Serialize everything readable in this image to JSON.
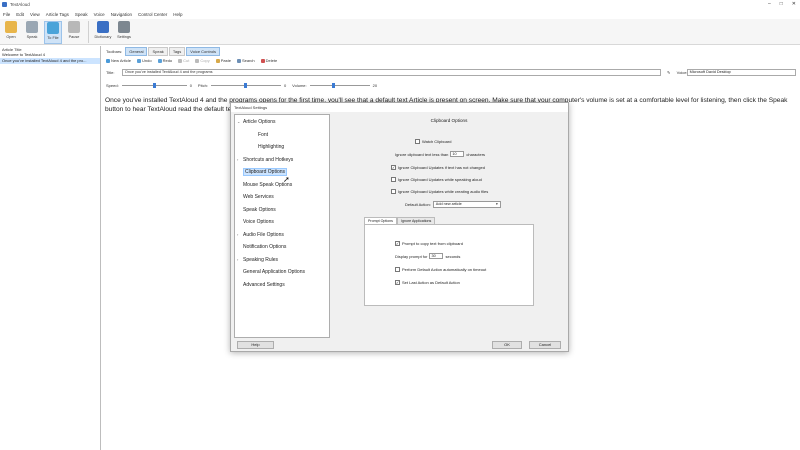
{
  "window": {
    "title": "TextAloud"
  },
  "menu": [
    "File",
    "Edit",
    "View",
    "Article Tags",
    "Speak",
    "Voice",
    "Navigation",
    "Control Center",
    "Help"
  ],
  "ribbon": [
    {
      "label": "Open",
      "color": "#e8b54a"
    },
    {
      "label": "Speak",
      "color": "#9aa7b3"
    },
    {
      "label": "To File",
      "color": "#4aa3d9"
    },
    {
      "label": "Pause",
      "color": "#b8b8b8"
    },
    {
      "label": "Dictionary",
      "color": "#3a6fc4"
    },
    {
      "label": "Settings",
      "color": "#7d8790"
    }
  ],
  "articles": {
    "header": "Article Title",
    "items": [
      "Welcome to TextAloud 4",
      "Once you've installed TextAloud 4 and the pro..."
    ]
  },
  "toolbars": {
    "label": "Toolbars:",
    "tabs": [
      "General",
      "Speak",
      "Tags",
      "Voice Controls"
    ]
  },
  "tools": [
    {
      "label": "New Article",
      "color": "#4a9ad9",
      "disabled": false
    },
    {
      "label": "Undo",
      "color": "#5aa0d8",
      "disabled": false
    },
    {
      "label": "Redo",
      "color": "#5aa0d8",
      "disabled": false
    },
    {
      "label": "Cut",
      "color": "#bbbbbb",
      "disabled": true
    },
    {
      "label": "Copy",
      "color": "#bbbbbb",
      "disabled": true
    },
    {
      "label": "Paste",
      "color": "#d7a94a",
      "disabled": false
    },
    {
      "label": "Search",
      "color": "#6d8fb5",
      "disabled": false
    },
    {
      "label": "Delete",
      "color": "#d05050",
      "disabled": false
    }
  ],
  "title_field": {
    "label": "Title:",
    "value": "Once you've installed TextAloud 4 and the programs"
  },
  "voice": {
    "label": "Voice:",
    "value": "Microsoft David Desktop"
  },
  "sliders": {
    "speed": {
      "label": "Speed:",
      "value": "0",
      "level": 0.5
    },
    "pitch": {
      "label": "Pitch:",
      "value": "0",
      "level": 0.5
    },
    "volume": {
      "label": "Volume:",
      "value": "20",
      "level": 0.4
    }
  },
  "document_text": "Once you've installed TextAloud 4 and the programs opens for the first time, you'll see that a default text Article is present on screen. Make sure that your computer's volume is set at a comfortable level for listening, then click the Speak button to hear TextAloud read the default text.",
  "dialog": {
    "title": "TextAloud Settings",
    "tree": [
      {
        "label": "Article Options",
        "level": 0,
        "expanded": true
      },
      {
        "label": "Font",
        "level": 1
      },
      {
        "label": "Highlighting",
        "level": 1
      },
      {
        "label": "Shortcuts and Hotkeys",
        "level": 0,
        "collapsed": true
      },
      {
        "label": "Clipboard Options",
        "level": 0,
        "selected": true
      },
      {
        "label": "Mouse Speak Options",
        "level": 0
      },
      {
        "label": "Web Services",
        "level": 0
      },
      {
        "label": "Speak Options",
        "level": 0
      },
      {
        "label": "Voice Options",
        "level": 0
      },
      {
        "label": "Audio File Options",
        "level": 0,
        "collapsed": true
      },
      {
        "label": "Notification Options",
        "level": 0
      },
      {
        "label": "Speaking Rules",
        "level": 0,
        "collapsed": true
      },
      {
        "label": "General Application Options",
        "level": 0
      },
      {
        "label": "Advanced Settings",
        "level": 0
      }
    ],
    "panel_title": "Clipboard Options",
    "watch_clipboard": {
      "label": "Watch Clipboard",
      "checked": false
    },
    "ignore_less": {
      "label": "Ignore clipboard text less than",
      "value": "10",
      "suffix": "characters"
    },
    "checks": [
      {
        "label": "Ignore Clipboard Updates if text has not changed",
        "checked": true
      },
      {
        "label": "Ignore Clipboard Updates while speaking aloud",
        "checked": false
      },
      {
        "label": "Ignore Clipboard Updates while creating audio files",
        "checked": false
      }
    ],
    "default_action": {
      "label": "Default Action:",
      "value": "Add new article"
    },
    "subtabs": [
      "Prompt Options",
      "Ignore Applications"
    ],
    "prompt": {
      "prompt_copy": {
        "label": "Prompt to copy text from clipboard",
        "checked": true
      },
      "display_for": {
        "label": "Display prompt for",
        "value": "30",
        "suffix": "seconds"
      },
      "perform_default": {
        "label": "Perform Default Action automatically on timeout",
        "checked": false
      },
      "set_last": {
        "label": "Set Last Action as Default Action",
        "checked": true
      }
    },
    "buttons": {
      "help": "Help",
      "ok": "OK",
      "cancel": "Cancel"
    }
  }
}
